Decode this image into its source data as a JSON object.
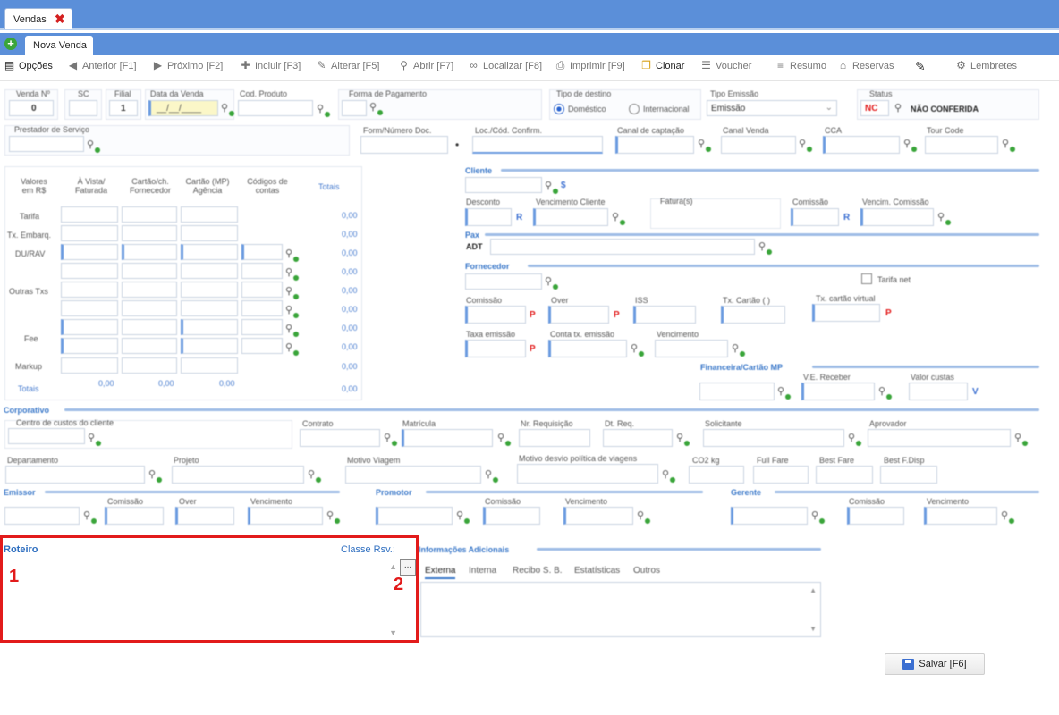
{
  "tabs": {
    "main": "Vendas",
    "sub": "Nova Venda"
  },
  "toolbar": {
    "opcoes": "Opções",
    "anterior": "Anterior [F1]",
    "proximo": "Próximo [F2]",
    "incluir": "Incluir [F3]",
    "alterar": "Alterar [F5]",
    "abrir": "Abrir [F7]",
    "localizar": "Localizar [F8]",
    "imprimir": "Imprimir [F9]",
    "clonar": "Clonar",
    "voucher": "Voucher",
    "resumo": "Resumo",
    "reservas": "Reservas",
    "lembretes": "Lembretes"
  },
  "header": {
    "venda_label": "Venda Nº",
    "venda_value": "0",
    "sc_label": "SC",
    "filial_label": "Filial",
    "filial_value": "1",
    "data_label": "Data da Venda",
    "data_value": "__/__/____",
    "cod_produto_label": "Cod. Produto",
    "forma_pagamento_label": "Forma de Pagamento",
    "tipo_destino_label": "Tipo de destino",
    "domestico": "Doméstico",
    "internacional": "Internacional",
    "tipo_emissao_label": "Tipo Emissão",
    "tipo_emissao_value": "Emissão",
    "status_label": "Status",
    "status_code": "NC",
    "status_value": "NÃO CONFERIDA"
  },
  "row2": {
    "prestador_label": "Prestador de Serviço",
    "form_label": "Form/Número Doc.",
    "loc_label": "Loc./Cód. Confirm.",
    "canal_captacao_label": "Canal de captação",
    "canal_venda_label": "Canal Venda",
    "cca_label": "CCA",
    "tour_code_label": "Tour Code"
  },
  "valores": {
    "headers": [
      "Valores em R$",
      "À Vista/ Faturada",
      "Cartão/ch. Fornecedor",
      "Cartão (MP) Agência",
      "Códigos de contas",
      "Totais"
    ],
    "rows": [
      "Tarifa",
      "Tx. Embarq.",
      "DU/RAV",
      "Outras Txs",
      "Fee",
      "Markup",
      "Totais"
    ],
    "zero": "0,00"
  },
  "cliente": {
    "section": "Cliente",
    "desconto_label": "Desconto",
    "venc_cliente_label": "Vencimento Cliente",
    "faturas_label": "Fatura(s)",
    "comissao_label": "Comissão",
    "venc_comissao_label": "Vencim. Comissão",
    "pax_section": "Pax",
    "pax_value": "ADT",
    "dollar": "$",
    "r": "R"
  },
  "fornecedor": {
    "section": "Fornecedor",
    "tarifa_net": "Tarifa net",
    "comissao_label": "Comissão",
    "over_label": "Over",
    "iss_label": "ISS",
    "tx_cartao_label": "Tx. Cartão ( )",
    "tx_cartao_virtual_label": "Tx. cartão virtual",
    "taxa_emissao_label": "Taxa emissão",
    "conta_tx_label": "Conta tx. emissão",
    "vencimento_label": "Vencimento",
    "p": "P"
  },
  "financeira": {
    "section": "Financeira/Cartão MP",
    "vl_receber_label": "V.E. Receber",
    "valor_custas_label": "Valor custas",
    "v": "V"
  },
  "corporativo": {
    "section": "Corporativo",
    "centro_label": "Centro de custos do cliente",
    "contrato_label": "Contrato",
    "matricula_label": "Matrícula",
    "requisicao_label": "Nr. Requisição",
    "dt_req_label": "Dt. Req.",
    "solicitante_label": "Solicitante",
    "aprovador_label": "Aprovador",
    "departamento_label": "Departamento",
    "projeto_label": "Projeto",
    "motivo_label": "Motivo Viagem",
    "motivo_desvio_label": "Motivo desvio política de viagens",
    "co2_label": "CO2 kg",
    "full_fare_label": "Full Fare",
    "best_fare_label": "Best Fare",
    "best_disp_label": "Best F.Disp"
  },
  "emissor": {
    "section": "Emissor",
    "comissao_label": "Comissão",
    "over_label": "Over",
    "vencimento_label": "Vencimento"
  },
  "promotor": {
    "section": "Promotor",
    "comissao_label": "Comissão",
    "vencimento_label": "Vencimento"
  },
  "gerente": {
    "section": "Gerente",
    "comissao_label": "Comissão",
    "vencimento_label": "Vencimento"
  },
  "roteiro": {
    "section": "Roteiro",
    "classe_label": "Classe Rsv.:",
    "ellipsis": "...",
    "marker1": "1",
    "marker2": "2"
  },
  "info": {
    "section": "Informações Adicionais",
    "tabs": [
      "Externa",
      "Interna",
      "Recibo S. B.",
      "Estatísticas",
      "Outros"
    ]
  },
  "salvar": "Salvar [F6]",
  "colors": {
    "tab_bar": "#5b8fd9",
    "accent": "#3a78c9",
    "highlight_red": "#e21b1b"
  }
}
